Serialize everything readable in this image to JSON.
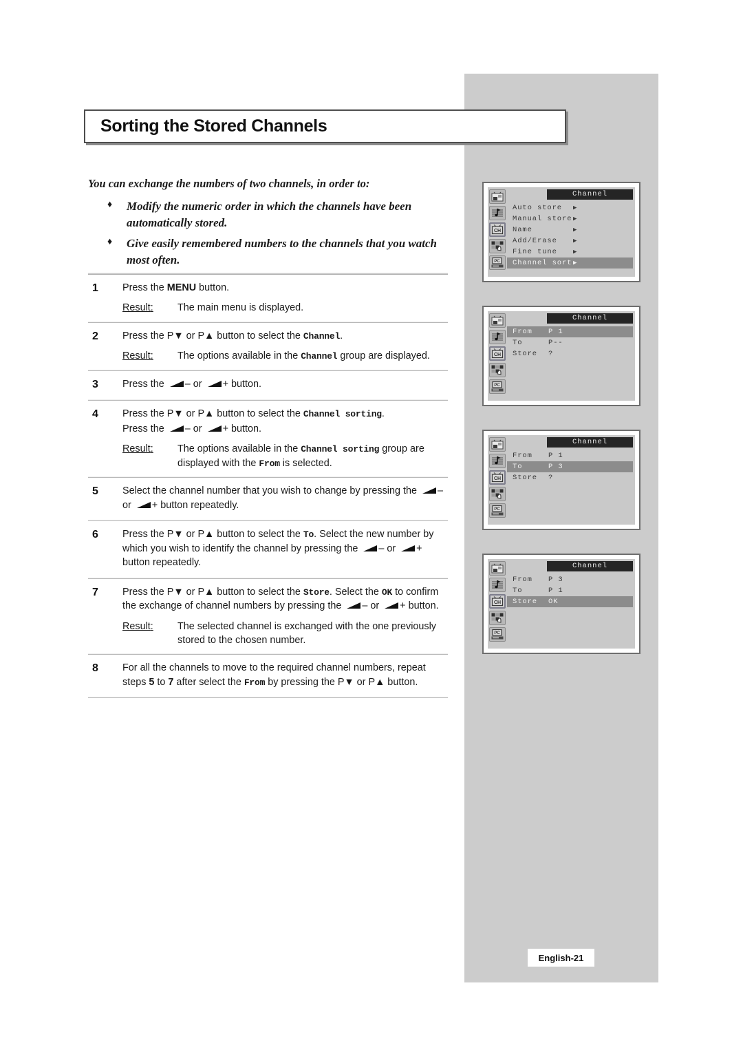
{
  "title": "Sorting the Stored Channels",
  "intro": {
    "lead": "You can exchange the numbers of two channels, in order to:",
    "bullets": [
      "Modify the numeric order in which the channels have been automatically stored.",
      "Give easily remembered numbers to the channels that you watch most often."
    ],
    "bullet_mark": "♦"
  },
  "labels": {
    "result": "Result",
    "menu_button": "MENU",
    "p_down": "P▼",
    "p_up": "P▲",
    "minus": "–",
    "plus": "+",
    "or": "or"
  },
  "steps": [
    {
      "num": "1",
      "lines": [
        "Press the |b:MENU| button."
      ],
      "result": "The main menu is displayed."
    },
    {
      "num": "2",
      "lines": [
        "Press the |P▼| or |P▲| button to select the |m:Channel|."
      ],
      "result": "The options available in the |m:Channel| group are displayed."
    },
    {
      "num": "3",
      "lines": [
        "Press the |vol|– or |vol|+ button."
      ],
      "result": ""
    },
    {
      "num": "4",
      "lines": [
        "Press the |P▼| or |P▲| button to select the |m:Channel sorting|.",
        "Press the |vol|– or |vol|+ button."
      ],
      "result": "The options available in the |m:Channel sorting| group are displayed with the |m:From| is selected."
    },
    {
      "num": "5",
      "lines": [
        "Select the channel number that you wish to change by pressing the |vol|– or |vol|+ button repeatedly."
      ],
      "result": ""
    },
    {
      "num": "6",
      "lines": [
        "Press the |P▼| or |P▲| button to select the |m:To|. Select the new number by which you wish to identify the channel by pressing the |vol|– or |vol|+ button repeatedly."
      ],
      "result": ""
    },
    {
      "num": "7",
      "lines": [
        "Press the |P▼| or |P▲| button to select the |m:Store|. Select the |m:OK| to confirm the exchange of channel numbers by pressing the |vol|– or |vol|+ button."
      ],
      "result": "The selected channel is exchanged with the one previously stored to the chosen number."
    },
    {
      "num": "8",
      "lines": [
        "For all the channels to move to the required channel numbers, repeat steps |b:5| to |b:7| after select the |m:From| by pressing the |P▼| or |P▲| button."
      ],
      "result": ""
    }
  ],
  "osd_menus": [
    {
      "title": "Channel",
      "style": "arrow",
      "rows": [
        {
          "label": "Auto store",
          "value": "",
          "arrow": "▶",
          "selected": false
        },
        {
          "label": "Manual store",
          "value": "",
          "arrow": "▶",
          "selected": false
        },
        {
          "label": "Name",
          "value": "",
          "arrow": "▶",
          "selected": false
        },
        {
          "label": "Add/Erase",
          "value": "",
          "arrow": "▶",
          "selected": false
        },
        {
          "label": "Fine tune",
          "value": "",
          "arrow": "▶",
          "selected": false
        },
        {
          "label": "Channel sort",
          "value": "",
          "arrow": "▶",
          "selected": true
        }
      ]
    },
    {
      "title": "Channel",
      "style": "value",
      "rows": [
        {
          "label": "From",
          "value": "P 1",
          "arrow": "",
          "selected": true
        },
        {
          "label": "To",
          "value": "P--",
          "arrow": "",
          "selected": false
        },
        {
          "label": "Store",
          "value": "?",
          "arrow": "",
          "selected": false
        }
      ]
    },
    {
      "title": "Channel",
      "style": "value",
      "rows": [
        {
          "label": "From",
          "value": "P 1",
          "arrow": "",
          "selected": false
        },
        {
          "label": "To",
          "value": "P 3",
          "arrow": "",
          "selected": true
        },
        {
          "label": "Store",
          "value": "?",
          "arrow": "",
          "selected": false
        }
      ]
    },
    {
      "title": "Channel",
      "style": "value",
      "rows": [
        {
          "label": "From",
          "value": "P 3",
          "arrow": "",
          "selected": false
        },
        {
          "label": "To",
          "value": "P 1",
          "arrow": "",
          "selected": false
        },
        {
          "label": "Store",
          "value": "OK",
          "arrow": "",
          "selected": true
        }
      ]
    }
  ],
  "osd_icons": [
    {
      "name": "picture-icon",
      "active": false
    },
    {
      "name": "sound-icon",
      "active": false
    },
    {
      "name": "channel-icon",
      "active": true,
      "text": "CH"
    },
    {
      "name": "setup-icon",
      "active": false
    },
    {
      "name": "pc-icon",
      "active": false,
      "text": "PC"
    }
  ],
  "footer": "English-21",
  "colors": {
    "panel_gray": "#cccccc",
    "osd_bg": "#c9c9c9",
    "osd_title_bg": "#252525",
    "osd_selected": "#8c8c8c"
  }
}
